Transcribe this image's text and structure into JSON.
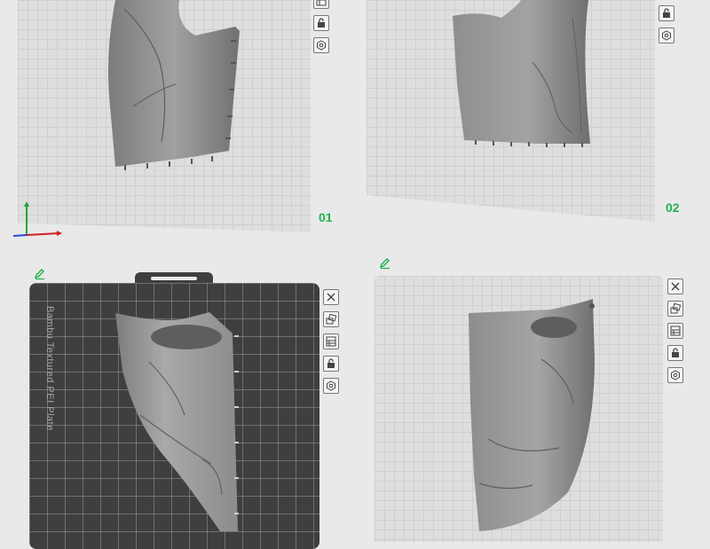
{
  "plates": [
    {
      "number": "01"
    },
    {
      "number": "02"
    },
    {
      "name": "Bambu Textured PEI Plate"
    },
    {}
  ],
  "icons": {
    "close": "close-icon",
    "arrange": "auto-arrange-icon",
    "layout": "plate-layout-icon",
    "lock": "lock-icon",
    "settings": "plate-settings-icon",
    "edit": "edit-pencil-icon"
  },
  "colors": {
    "plate_number": "#1db24a",
    "edit_icon": "#1db24a",
    "axis_x": "#d22020",
    "axis_y": "#1ea83a",
    "axis_z": "#2b48d8"
  }
}
